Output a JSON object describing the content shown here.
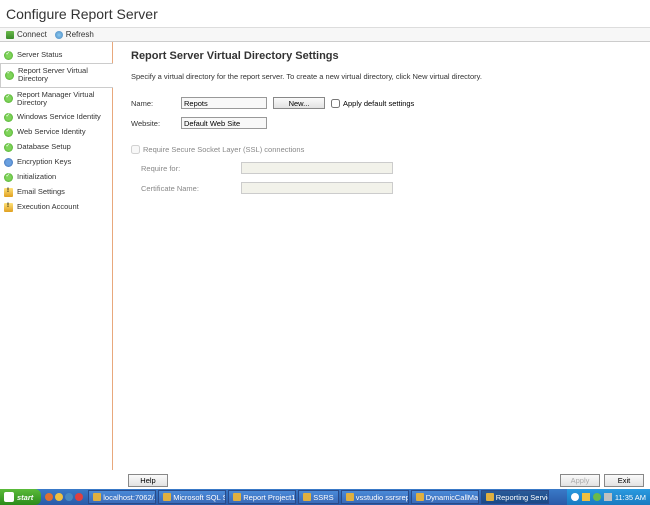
{
  "header": {
    "title": "Configure Report Server"
  },
  "toolbar": {
    "connect": "Connect",
    "refresh": "Refresh"
  },
  "sidebar": {
    "items": [
      {
        "label": "Server Status",
        "icon": "green"
      },
      {
        "label": "Report Server Virtual Directory",
        "icon": "green",
        "selected": true
      },
      {
        "label": "Report Manager Virtual Directory",
        "icon": "green"
      },
      {
        "label": "Windows Service Identity",
        "icon": "green"
      },
      {
        "label": "Web Service Identity",
        "icon": "green"
      },
      {
        "label": "Database Setup",
        "icon": "green"
      },
      {
        "label": "Encryption Keys",
        "icon": "blue"
      },
      {
        "label": "Initialization",
        "icon": "green"
      },
      {
        "label": "Email Settings",
        "icon": "yellow"
      },
      {
        "label": "Execution Account",
        "icon": "yellow"
      }
    ]
  },
  "content": {
    "heading": "Report Server Virtual Directory Settings",
    "desc": "Specify a virtual directory for the report server. To create a new virtual directory, click New virtual directory.",
    "name_label": "Name:",
    "name_value": "Repots",
    "website_label": "Website:",
    "website_value": "Default Web Site",
    "new_btn": "New...",
    "apply_defaults": "Apply default settings",
    "ssl_require": "Require Secure Socket Layer (SSL) connections",
    "require_for": "Require for:",
    "cert_name": "Certificate Name:"
  },
  "footer": {
    "help": "Help",
    "apply": "Apply",
    "exit": "Exit"
  },
  "taskbar": {
    "start": "start",
    "items": [
      "localhost:7062/...",
      "Microsoft SQL S...",
      "Report Project1...",
      "SSRS",
      "vsstudio ssrsrep...",
      "DynamicCallMas...",
      "Reporting Servic..."
    ],
    "clock": "11:35 AM"
  }
}
